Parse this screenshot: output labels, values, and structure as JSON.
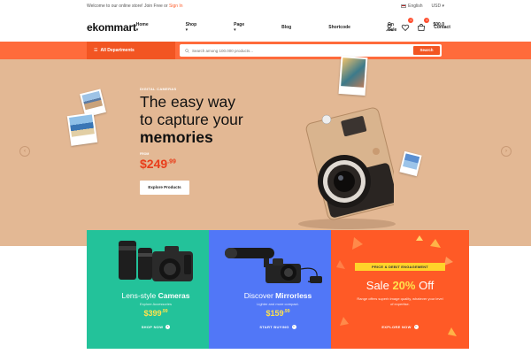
{
  "topbar": {
    "welcome": "Welcome to our online store! Join Free or",
    "signin": "Sign In",
    "language": "English",
    "currency": "USD"
  },
  "header": {
    "logo": "ekommart",
    "nav": [
      {
        "label": "Home",
        "dropdown": true
      },
      {
        "label": "Shop",
        "dropdown": true
      },
      {
        "label": "Page",
        "dropdown": true
      },
      {
        "label": "Blog",
        "dropdown": false
      },
      {
        "label": "Shortcode",
        "dropdown": false
      },
      {
        "label": "On Sale",
        "dropdown": false
      },
      {
        "label": "Contact",
        "dropdown": false
      }
    ],
    "wishlist_count": "0",
    "cart_count": "0",
    "cart_total": "$00.0"
  },
  "searchbar": {
    "departments_label": "All Departments",
    "placeholder": "Search among 100.000 products...",
    "search_button": "Search"
  },
  "hero": {
    "label": "DIGITAL CAMERAS",
    "title_line1": "The easy way",
    "title_line2": "to capture your",
    "title_bold": "memories",
    "from": "FROM",
    "price_main": "$249",
    "price_cents": ".99",
    "button": "Explore Products",
    "arrow_prev": "‹",
    "arrow_next": "›"
  },
  "cards": [
    {
      "title_light": "Lens-style",
      "title_bold": "Cameras",
      "sub": "Explore Accessories",
      "price_main": "$399",
      "price_cents": ".99",
      "link": "SHOP NOW"
    },
    {
      "title_light": "Discover",
      "title_bold": "Mirrorless",
      "sub": "Lighter and more compact.",
      "price_main": "$159",
      "price_cents": ".99",
      "link": "START BUYING"
    },
    {
      "tag": "PRICE & DEBIT ENGAGEMENT",
      "title_light": "Sale",
      "title_bold": "20%",
      "title_end": "Off",
      "desc": "Range offers superb image quality, whatever your level of expertise.",
      "link": "EXPLORE NOW"
    }
  ],
  "colors": {
    "accent": "#ff6b3b",
    "hero_bg": "#e3b894",
    "card_green": "#23c29a",
    "card_blue": "#5177f7",
    "card_orange": "#ff5a26",
    "price_red": "#e93d1a",
    "price_yellow": "#ffe24d"
  }
}
